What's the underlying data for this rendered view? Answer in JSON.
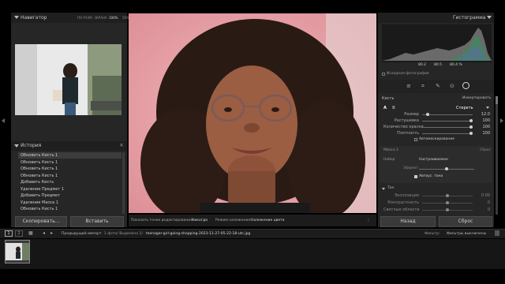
{
  "navigator": {
    "title": "Навигатор",
    "zoom_options": [
      "ПО РАЗМ. ЭКРАНА",
      "100%",
      "50%"
    ]
  },
  "history": {
    "title": "История",
    "close_glyph": "×",
    "items": [
      "Обновить Кисть 1",
      "Обновить Кисть 1",
      "Обновить Кисть 1",
      "Обновить Кисть 1",
      "Добавить Кисть",
      "Удаление Предмет 1",
      "Добавить Предмет",
      "Удаление Маска 1",
      "Обновить Кисть 1"
    ],
    "selected_index": 0
  },
  "left_buttons": {
    "copy": "Скопировать...",
    "paste": "Вставить"
  },
  "histogram": {
    "title": "Гистограмма",
    "readouts": [
      "80.2",
      "80.5",
      "80.4 %"
    ],
    "original_photo": "Исходная фотография"
  },
  "brush": {
    "label": "Кисть",
    "invert": "Инвертировать",
    "preset_a": "A",
    "preset_b": "B",
    "erase": "Стереть",
    "sliders": [
      {
        "label": "Размер",
        "value": "12.0",
        "level": 0.08
      },
      {
        "label": "Растушевка",
        "value": "100",
        "level": 1.0
      },
      {
        "label": "Количество краски",
        "value": "100",
        "level": 1.0
      },
      {
        "label": "Плотность",
        "value": "100",
        "level": 1.0
      }
    ],
    "automask": "Автомаскирование"
  },
  "mask": {
    "label": "Маска 1",
    "reset": "Сброс",
    "preset_label": "Набор",
    "preset_value": "Настраиваемое",
    "amount_label": "Эффект",
    "auto_tone": "Автоус. тона"
  },
  "tone": {
    "label": "Тон",
    "rows": [
      {
        "label": "Экспозиция",
        "value": "0.00"
      },
      {
        "label": "Контрастность",
        "value": "0"
      },
      {
        "label": "Светлые области",
        "value": "0"
      }
    ]
  },
  "right_buttons": {
    "prev": "Назад",
    "reset": "Сброс"
  },
  "toolbar": {
    "show_pins_label": "Показать точки редактирования:",
    "show_pins_value": "Никогда",
    "overlay_label": "Режим наложения:",
    "overlay_value": "Наложение цвета"
  },
  "filmstrip": {
    "pages": [
      "1",
      "2"
    ],
    "breadcrumb": "Предыдущий импорт",
    "count": "1 фото/ Выделено 1/",
    "filename": "teenager-girl-going-shopping-2023-11-27-05-22-18-utc.jpg",
    "filter_label": "Фильтр:",
    "filter_value": "Фильтры выключены"
  },
  "colors": {
    "photo_bg": "#e8a3a8",
    "panel": "#262626",
    "accent_text": "#d0d0d0"
  }
}
